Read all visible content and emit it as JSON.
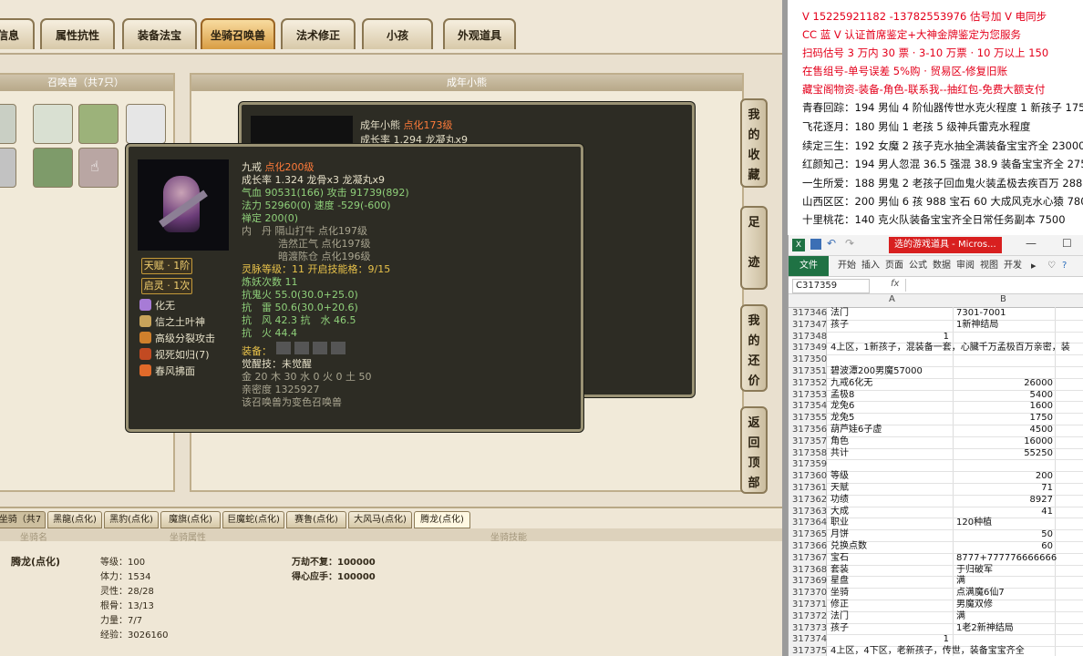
{
  "tabs": [
    "信息",
    "属性抗性",
    "装备法宝",
    "坐骑召唤兽",
    "法术修正",
    "小孩",
    "外观道具"
  ],
  "active_tab": "坐骑召唤兽",
  "pet_panel_title": "召唤兽（共7只）",
  "child_panel_title": "成年小熊",
  "side_buttons": [
    "我的收藏",
    "足迹",
    "我的还价",
    "返回顶部"
  ],
  "tooltip_back": {
    "line1_name": "成年小熊",
    "line1_level": "点化173级",
    "line2": "成长率 1.294 龙凝丸x9"
  },
  "tooltip": {
    "name": "九戒",
    "level": "点化200级",
    "growth": "成长率 1.324 龙骨x3 龙凝丸x9",
    "hp": "气血 90531(166) 攻击 91739(892)",
    "mp": "法力 52960(0) 速度 -529(-600)",
    "calm": "禅定 200(0)",
    "dan1": "内　丹 隔山打牛 点化197级",
    "dan2": "浩然正气 点化197级",
    "dan3": "暗渡陈仓 点化196级",
    "linghu": "灵脉等级：11 开启技能格：9/15",
    "lianyao": "炼妖次数 11",
    "kang1": "抗鬼火 55.0(30.0+25.0)",
    "kang2": "抗　雷 50.6(30.0+20.6)",
    "kang3": "抗　风 42.3 抗　水 46.5",
    "kang4": "抗　火 44.4",
    "equip_label": "装备：",
    "awaken": "觉醒技：未觉醒",
    "elements": "金 20 木 30 水 0 火 0 土 50",
    "intimacy": "亲密度 1325927",
    "note": "该召唤兽为变色召唤兽",
    "badge1": "天赋 · 1阶",
    "badge2": "启灵 · 1次",
    "skills": [
      "化无",
      "信之土叶神",
      "高级分裂攻击",
      "视死如归(7)",
      "春风拂面"
    ]
  },
  "mount": {
    "title": "坐骑（共7只）",
    "tabs": [
      "黑龍(点化)",
      "黑豹(点化)",
      "魔旗(点化)",
      "巨魔蛇(点化)",
      "赛鲁(点化)",
      "大风马(点化)",
      "腾龙(点化)"
    ],
    "col_headers": [
      "坐骑名",
      "坐骑属性",
      "坐骑技能"
    ],
    "name": "腾龙(点化)",
    "stats": [
      "等级：100",
      "体力：1534",
      "灵性：28/28",
      "根骨：13/13",
      "力量：7/7",
      "经验：3026160"
    ],
    "skills": [
      "万劫不复：100000",
      "得心应手：100000"
    ]
  },
  "notes": [
    {
      "text": "V 15225921182 -13782553976 估号加 V 电同步",
      "color": "#e4001b"
    },
    {
      "text": "CC 蓝 V 认证首席鉴定+大神金牌鉴定为您服务",
      "color": "#e4001b"
    },
    {
      "text": "扫码估号 3 万内 30 票 · 3-10 万票 · 10 万以上 150",
      "color": "#e4001b"
    },
    {
      "text": "在售组号-单号误差 5%购 · 贸易区-修复旧账",
      "color": "#e4001b"
    },
    {
      "text": "藏宝阁物资-装备-角色-联系我--抽红包-免费大额支付",
      "color": "#e4001b"
    },
    {
      "text": "青春回踪：194 男仙 4 阶仙器传世水克火程度 1 新孩子 17500",
      "color": "#111"
    },
    {
      "text": "飞花逐月：180 男仙 1 老孩 5 级神兵雷克水程度",
      "color": "#111"
    },
    {
      "text": "续定三生：192 女魔 2 孩子克水抽全满装备宝宝齐全 23000",
      "color": "#111"
    },
    {
      "text": "红颜知己：194 男人忽混 36.5 强混 38.9 装备宝宝齐全 27500",
      "color": "#111"
    },
    {
      "text": "一生所爱：188 男鬼 2 老孩子回血鬼火装孟极去疾百万 28888",
      "color": "#111"
    },
    {
      "text": "山西区区：200 男仙 6 孩 988 宝石 60 大成风克水心猿 78000",
      "color": "#111"
    },
    {
      "text": "十里桃花：140 克火队装备宝宝齐全日常任务副本 7500",
      "color": "#111"
    }
  ],
  "excel": {
    "title_badge": "选的游戏道具 - Micros...",
    "ribbon": [
      "文件",
      "开始",
      "插入",
      "页面",
      "公式",
      "数据",
      "审阅",
      "视图",
      "开发"
    ],
    "name_box": "C317359",
    "fx": "fx",
    "col_headers": [
      "A",
      "B"
    ],
    "rows": [
      {
        "n": "317346",
        "a": "法门",
        "b": "7301-7001"
      },
      {
        "n": "317347",
        "a": "孩子",
        "b": "1新神结局"
      },
      {
        "n": "317348",
        "a": "",
        "ar": "1",
        "b": ""
      },
      {
        "n": "317349",
        "a": "4上区，1新孩子，混装备一套，心臟千万孟极百万亲密，装",
        "b": ""
      },
      {
        "n": "317350",
        "a": "",
        "b": ""
      },
      {
        "n": "317351",
        "a": "碧波潭200男魔57000",
        "b": ""
      },
      {
        "n": "317352",
        "a": "九戒6化无",
        "br": "26000"
      },
      {
        "n": "317353",
        "a": "孟极8",
        "br": "5400"
      },
      {
        "n": "317354",
        "a": "龙兔6",
        "br": "1600"
      },
      {
        "n": "317355",
        "a": "龙兔5",
        "br": "1750"
      },
      {
        "n": "317356",
        "a": "葫芦娃6子虚",
        "br": "4500"
      },
      {
        "n": "317357",
        "a": "角色",
        "br": "16000"
      },
      {
        "n": "317358",
        "a": "共计",
        "br": "55250"
      },
      {
        "n": "317359",
        "a": "",
        "b": ""
      },
      {
        "n": "317360",
        "a": "等级",
        "br": "200"
      },
      {
        "n": "317361",
        "a": "天赋",
        "br": "71"
      },
      {
        "n": "317362",
        "a": "功绩",
        "br": "8927"
      },
      {
        "n": "317363",
        "a": "大成",
        "br": "41"
      },
      {
        "n": "317364",
        "a": "职业",
        "b": "120种植"
      },
      {
        "n": "317365",
        "a": "月饼",
        "br": "50"
      },
      {
        "n": "317366",
        "a": "兑换点数",
        "br": "60"
      },
      {
        "n": "317367",
        "a": "宝石",
        "b": "8777+777776666666"
      },
      {
        "n": "317368",
        "a": "套装",
        "b": "于归破军"
      },
      {
        "n": "317369",
        "a": "星盘",
        "b": "满"
      },
      {
        "n": "317370",
        "a": "坐骑",
        "b": "点满魔6仙7"
      },
      {
        "n": "317371",
        "a": "修正",
        "b": "男魔双修"
      },
      {
        "n": "317372",
        "a": "法门",
        "b": "满"
      },
      {
        "n": "317373",
        "a": "孩子",
        "b": "1老2新神结局"
      },
      {
        "n": "317374",
        "a": "",
        "ar": "1",
        "b": ""
      },
      {
        "n": "317375",
        "a": "4上区，4下区，老新孩子，传世，装备宝宝齐全",
        "b": ""
      }
    ]
  }
}
